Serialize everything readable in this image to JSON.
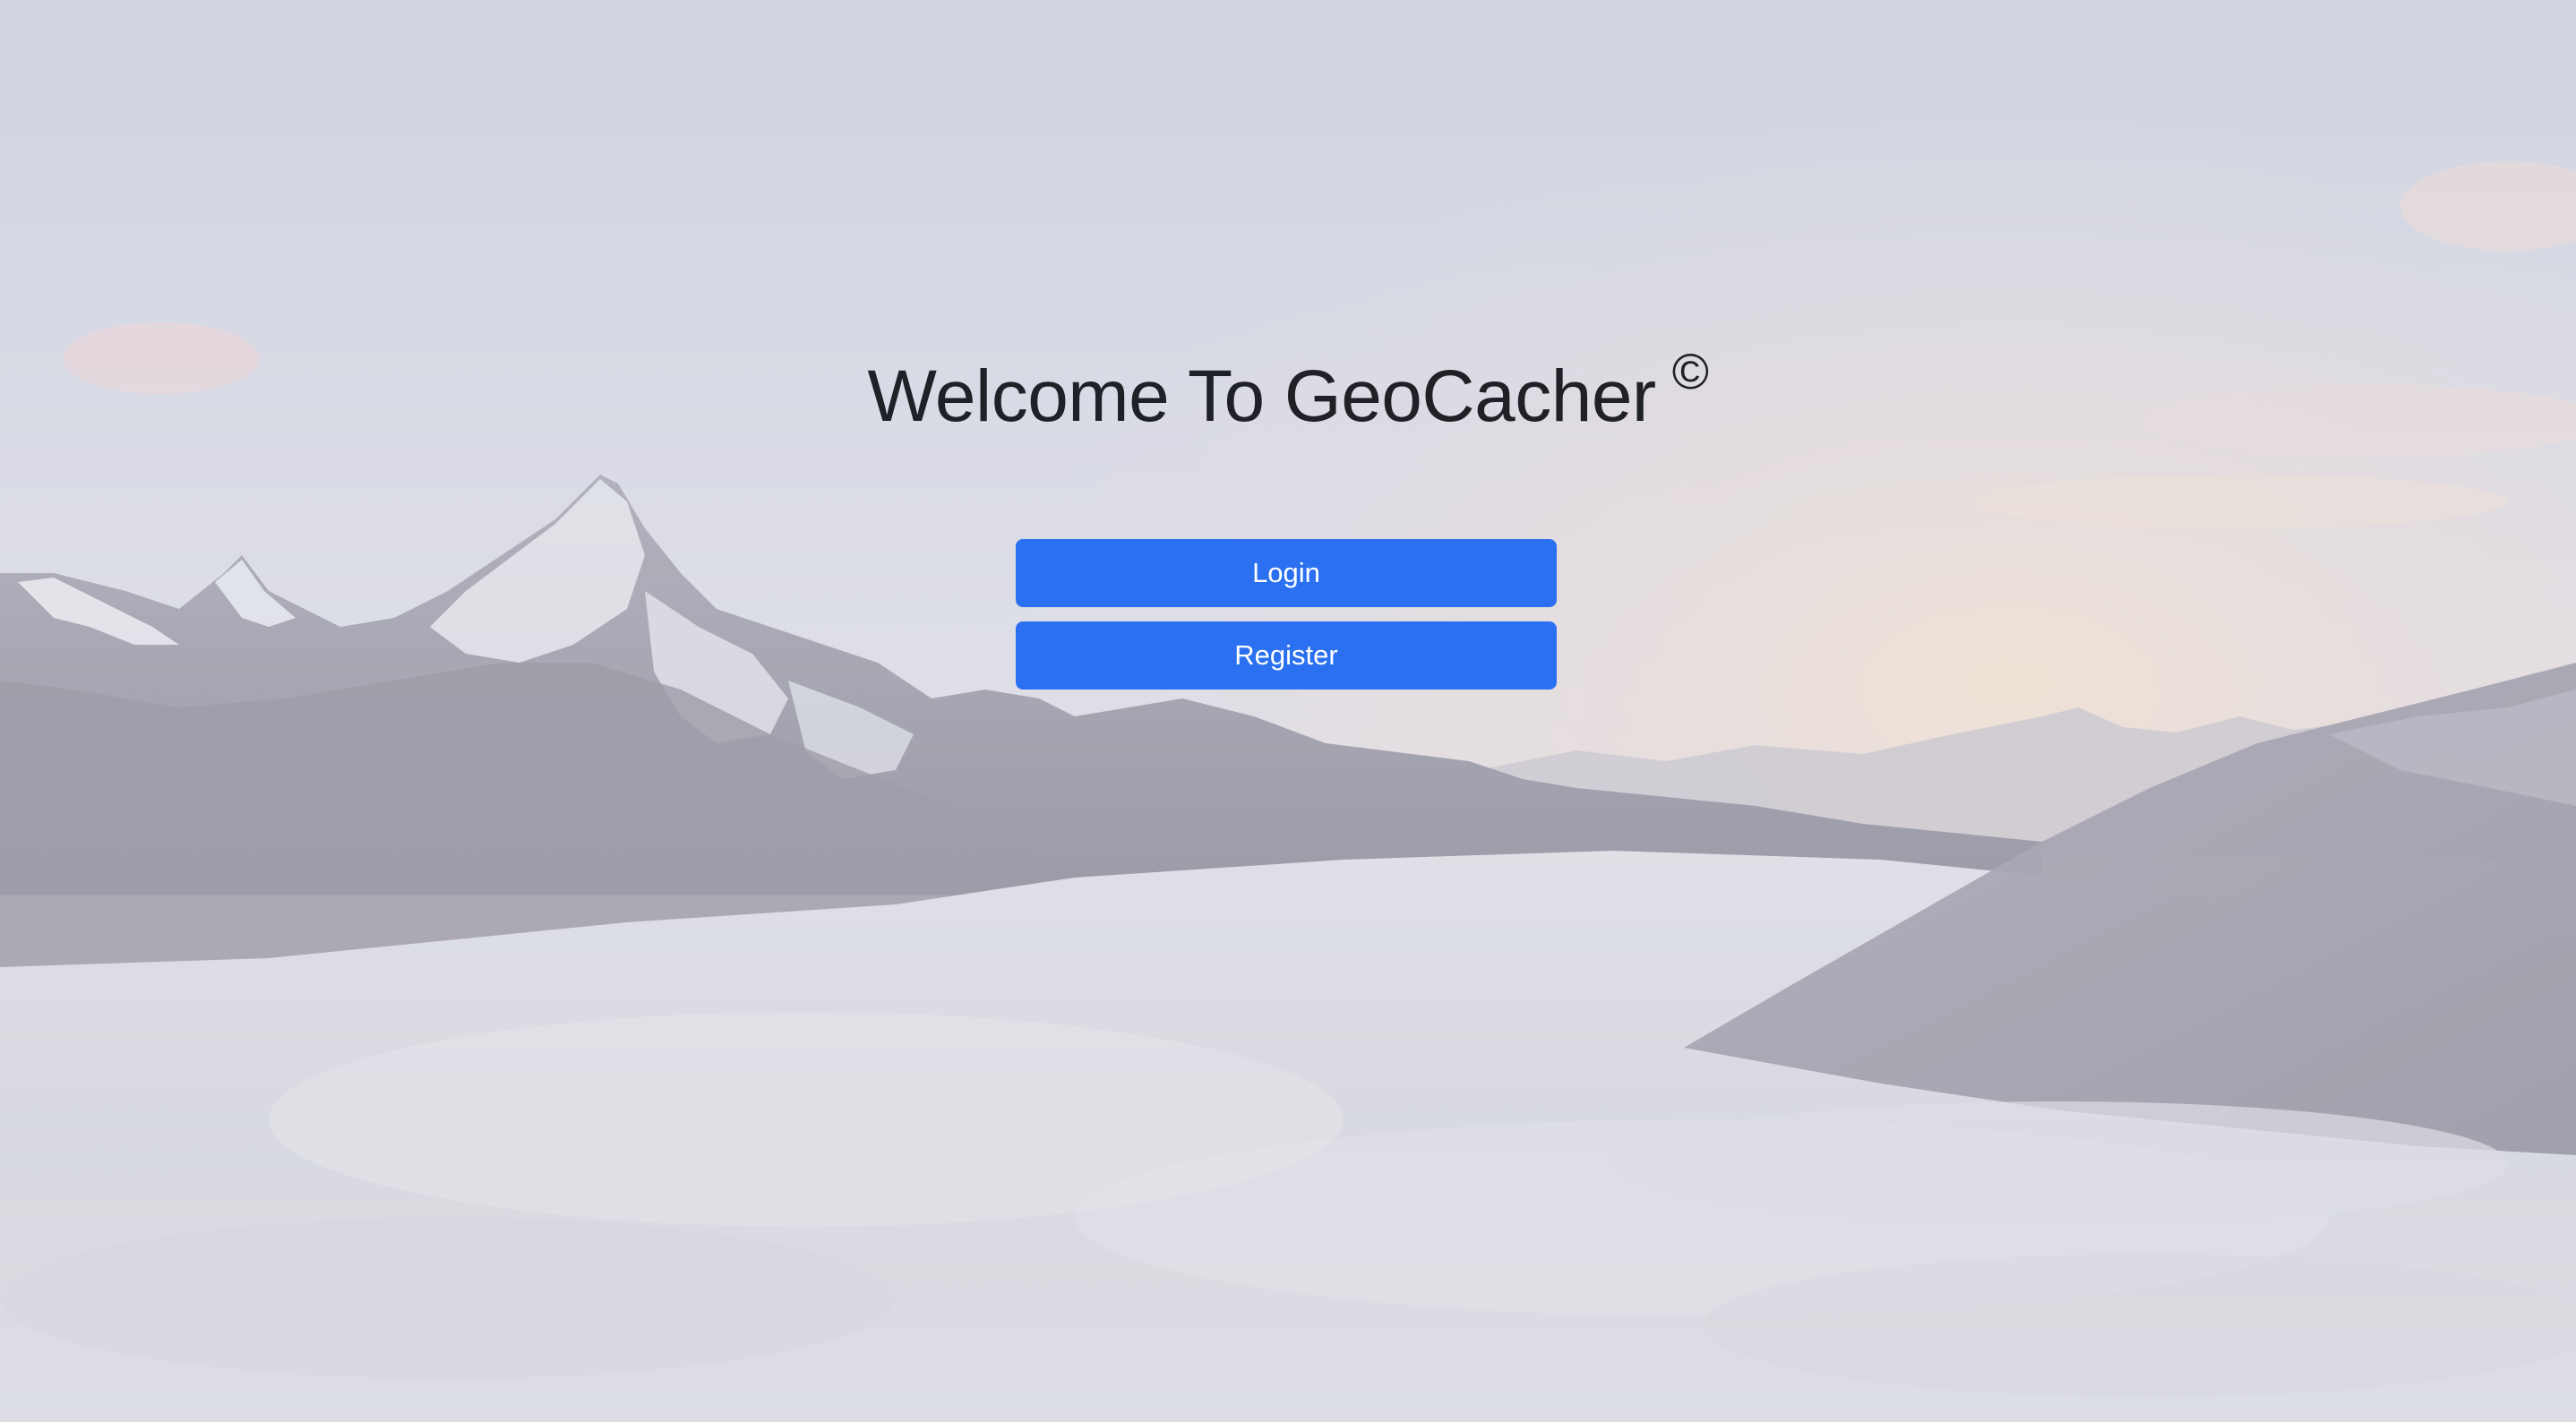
{
  "page": {
    "title": "Welcome To GeoCacher",
    "title_mark": "©",
    "background": "mountain-range-above-clouds"
  },
  "actions": {
    "login_label": "Login",
    "register_label": "Register"
  },
  "colors": {
    "primary_button": "#2a70f0",
    "button_text": "#ffffff",
    "title_text": "#1f2126"
  }
}
